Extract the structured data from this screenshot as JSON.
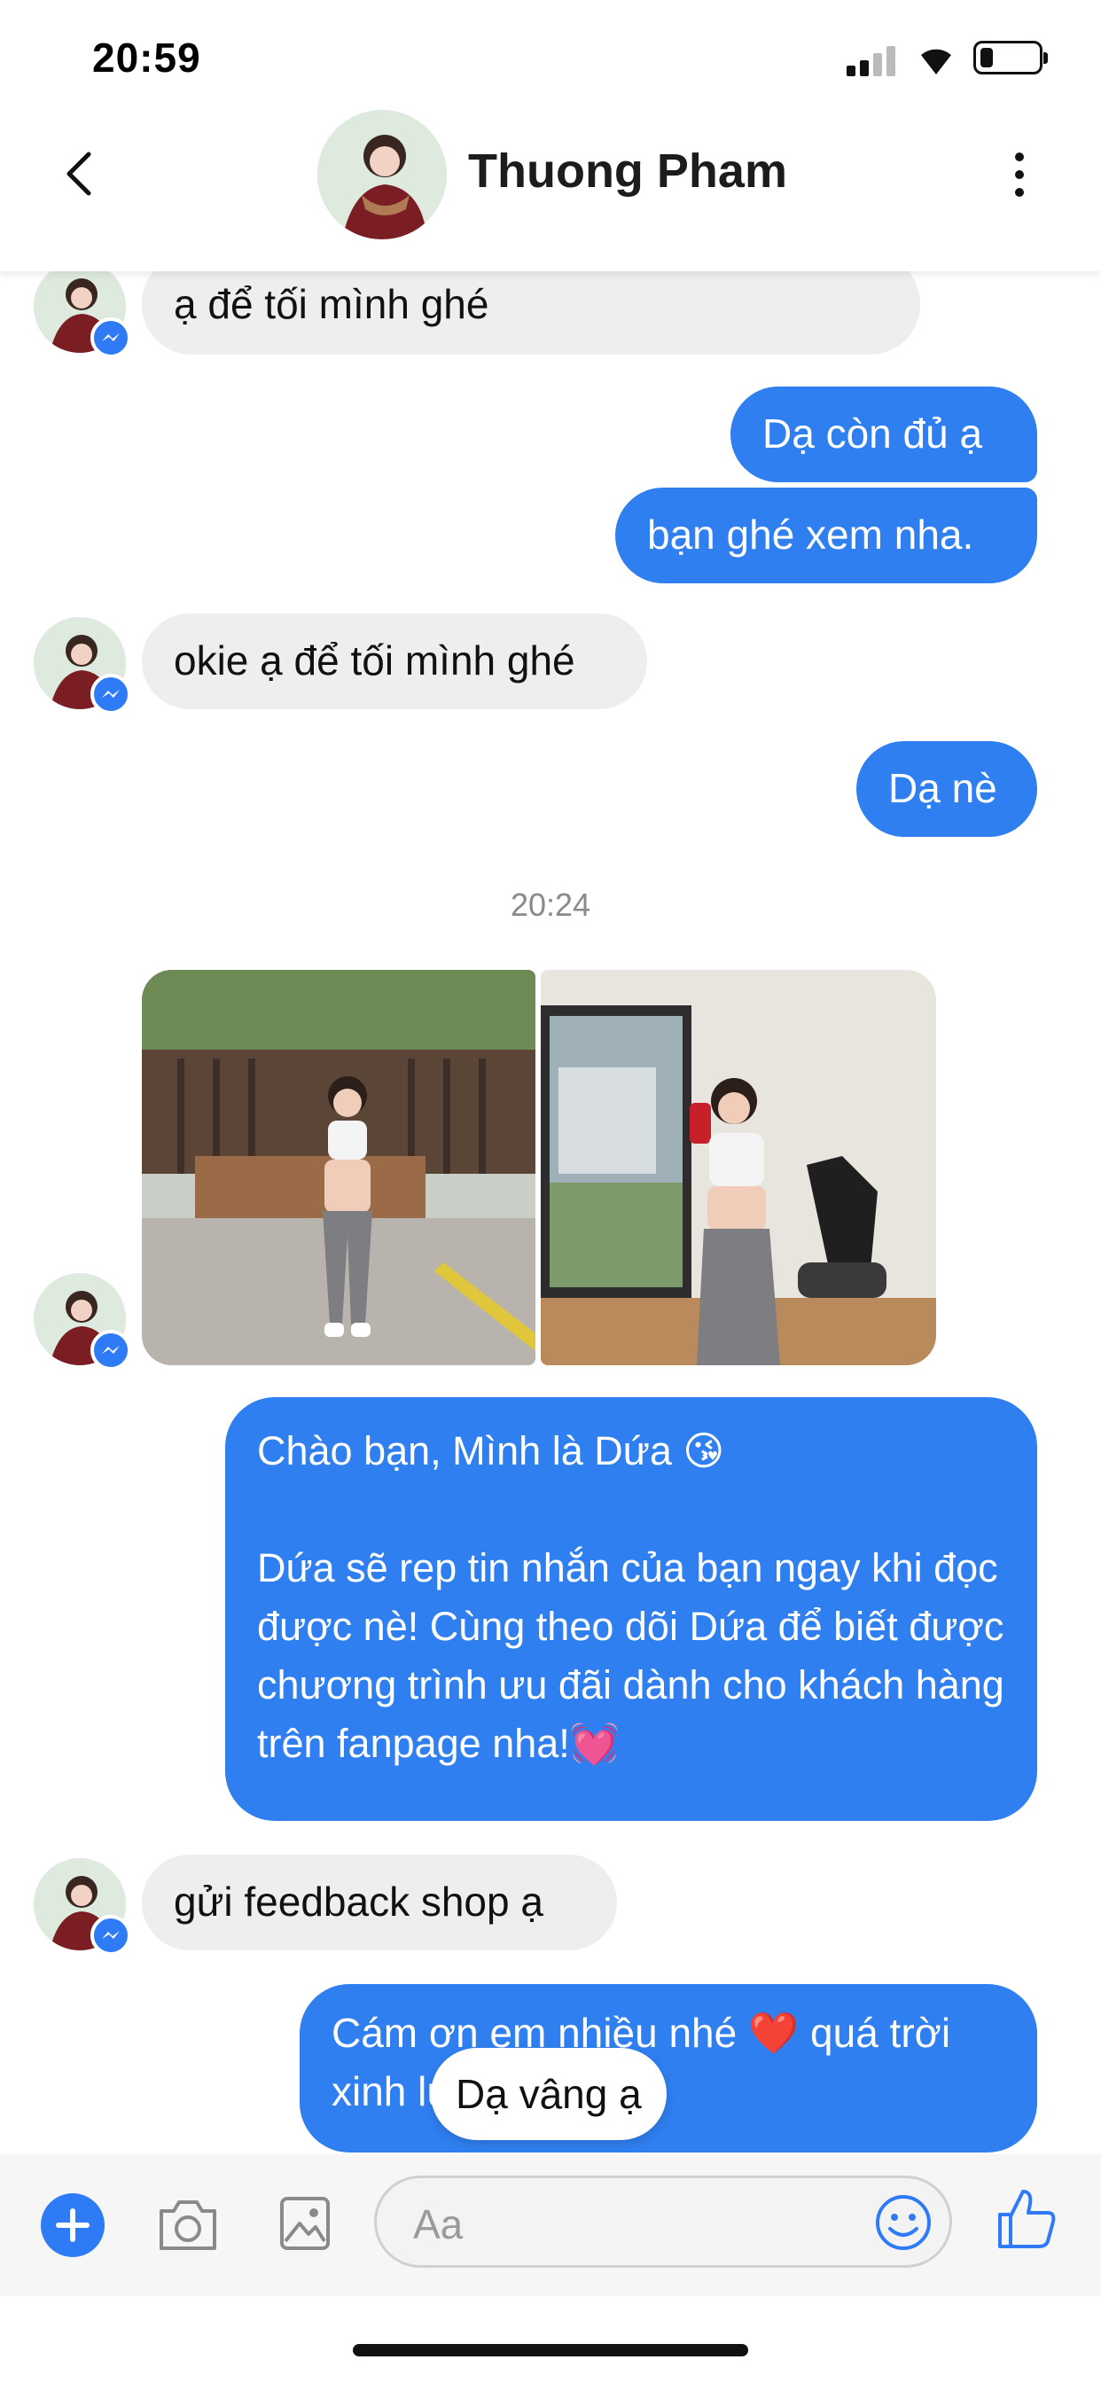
{
  "status_bar": {
    "time": "20:59"
  },
  "header": {
    "contact_name": "Thuong Pham"
  },
  "messages": {
    "m1": "ạ để tối mình ghé",
    "m2": "Dạ còn đủ ạ",
    "m3": "bạn ghé xem nha.",
    "m4": "okie ạ để tối mình ghé",
    "m5": "Dạ nè",
    "timestamp": "20:24",
    "m6_line1": "Chào bạn, Mình là Dứa 😘",
    "m6_line2": "Dứa sẽ rep tin nhắn của bạn ngay khi đọc được nè! Cùng theo dõi Dứa để biết được chương trình ưu đãi dành cho khách hàng trên fanpage nha!💓",
    "m7": "gửi feedback shop ạ",
    "m8": "Cám ơn em nhiều nhé ❤️ quá trời xinh luôn"
  },
  "quick_reply": "Dạ vâng ạ",
  "composer": {
    "placeholder": "Aa"
  },
  "colors": {
    "accent": "#2f7ff1",
    "incoming": "#eeeeee"
  },
  "icons": [
    "back-icon",
    "more-icon",
    "messenger-badge-icon",
    "plus-icon",
    "camera-icon",
    "gallery-icon",
    "emoji-icon",
    "like-icon"
  ]
}
